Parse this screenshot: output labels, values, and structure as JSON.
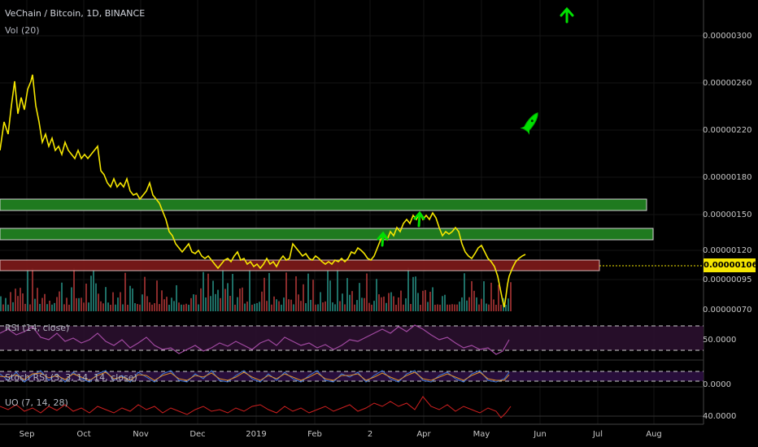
{
  "header": {
    "symbol_line": "VeChain / Bitcoin, 1D, BINANCE",
    "volume_label": "Vol (20)"
  },
  "price_axis": {
    "labels": [
      "0.00000300",
      "0.00000260",
      "0.00000220",
      "0.00000180",
      "0.00000150",
      "0.00000120",
      "0.00000095",
      "0.00000070"
    ],
    "current_badge": "0.00000106"
  },
  "indicators": {
    "rsi": {
      "label": "RSI (14, close)",
      "value_label": "50.0000"
    },
    "stoch": {
      "label": "Stoch RSI (3, 3, 14, 14, close)",
      "value_label": "0.0000"
    },
    "uo": {
      "label": "UO (7, 14, 28)",
      "value_label": "40.0000"
    }
  },
  "time_axis": {
    "labels": [
      "Sep",
      "Oct",
      "Nov",
      "Dec",
      "2019",
      "Feb",
      "2",
      "Apr",
      "May",
      "Jun",
      "Jul",
      "Aug"
    ]
  },
  "colors": {
    "price_line": "#f5e600",
    "zone_green": "#1f7a1f",
    "zone_red": "#7a1a1a",
    "arrow_green": "#00e000",
    "vol_up": "#1e6f66",
    "vol_down": "#8a2b2b",
    "rsi": "#8e3b8e",
    "uo": "#d02020"
  },
  "icons": [
    "up-arrow-icon",
    "rocket-icon"
  ]
}
